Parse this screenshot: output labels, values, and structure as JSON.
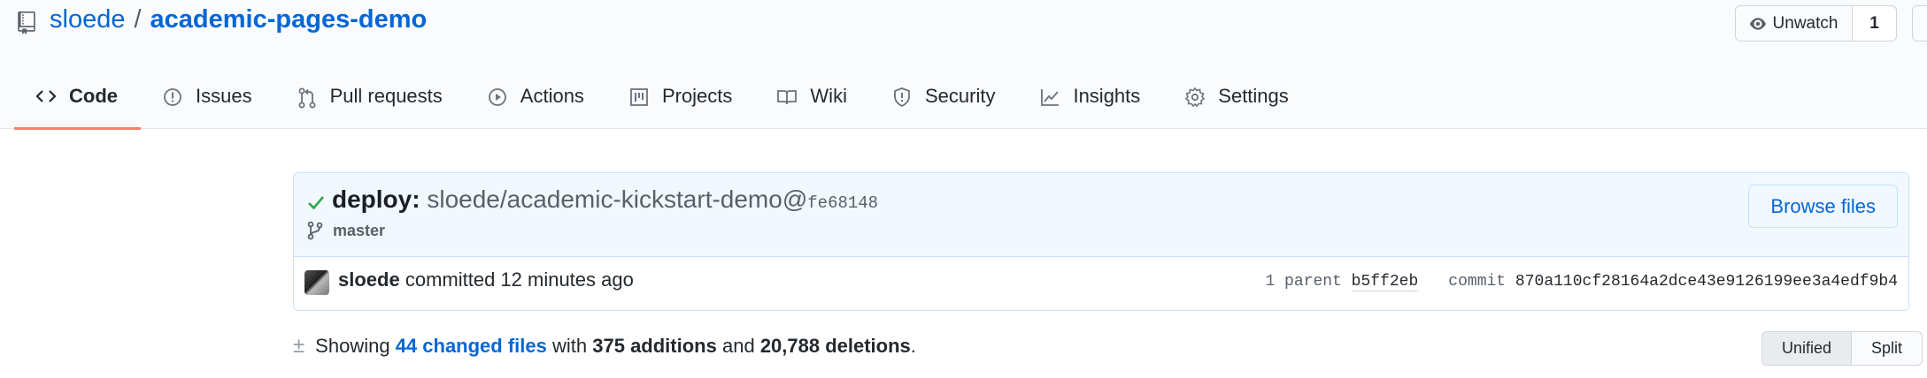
{
  "repo": {
    "owner": "sloede",
    "separator": "/",
    "name": "academic-pages-demo",
    "watch_label": "Unwatch",
    "watch_count": "1"
  },
  "tabs": [
    {
      "label": "Code",
      "icon": "code-icon",
      "active": true
    },
    {
      "label": "Issues",
      "icon": "issue-icon"
    },
    {
      "label": "Pull requests",
      "icon": "pull-request-icon"
    },
    {
      "label": "Actions",
      "icon": "play-icon"
    },
    {
      "label": "Projects",
      "icon": "project-icon"
    },
    {
      "label": "Wiki",
      "icon": "book-icon"
    },
    {
      "label": "Security",
      "icon": "shield-icon"
    },
    {
      "label": "Insights",
      "icon": "graph-icon"
    },
    {
      "label": "Settings",
      "icon": "gear-icon"
    }
  ],
  "commit": {
    "title_bold": "deploy:",
    "title_rest": "sloede/academic-kickstart-demo@",
    "title_sha": "fe68148",
    "branch": "master",
    "browse_label": "Browse files",
    "author": "sloede",
    "committed_text": "committed 12 minutes ago",
    "parent_label": "1 parent",
    "parent_sha": "b5ff2eb",
    "commit_label": "commit",
    "commit_sha": "870a110cf28164a2dce43e9126199ee3a4edf9b4"
  },
  "summary": {
    "showing": "Showing",
    "changed_files": "44 changed files",
    "with": "with",
    "additions": "375 additions",
    "and": "and",
    "deletions": "20,788 deletions",
    "period": "."
  },
  "view_toggle": {
    "unified": "Unified",
    "split": "Split"
  },
  "colors": {
    "accent": "#0366d6",
    "tab_underline": "#f9826c",
    "success": "#28a745",
    "commit_bg": "#f1f8ff"
  }
}
